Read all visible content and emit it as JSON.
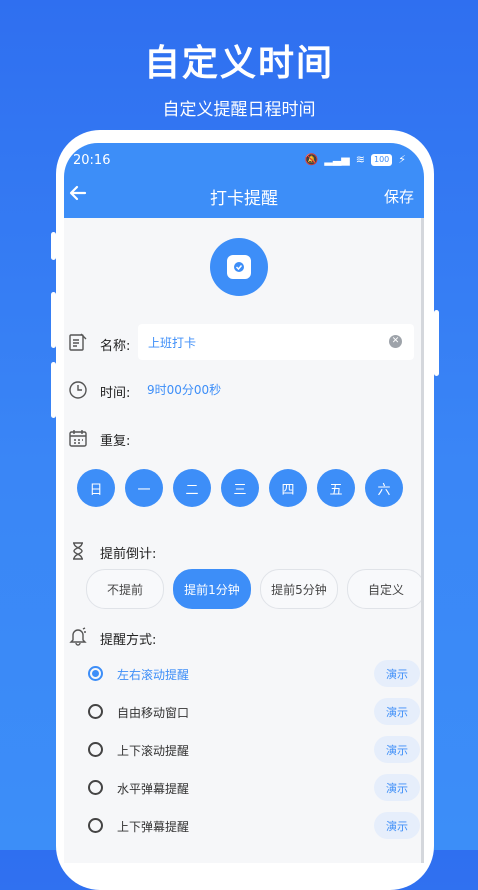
{
  "promo": {
    "headline": "自定义时间",
    "subline": "自定义提醒日程时间"
  },
  "status_bar": {
    "time": "20:16",
    "battery": "100"
  },
  "nav": {
    "title": "打卡提醒",
    "save_label": "保存"
  },
  "form": {
    "name_label": "名称:",
    "name_value": "上班打卡",
    "time_label": "时间:",
    "time_value": "9时00分00秒",
    "repeat_label": "重复:",
    "days": [
      "日",
      "一",
      "二",
      "三",
      "四",
      "五",
      "六"
    ],
    "countdown_label": "提前倒计:",
    "countdown_options": [
      "不提前",
      "提前1分钟",
      "提前5分钟",
      "自定义"
    ],
    "countdown_selected": "提前1分钟",
    "mode_label": "提醒方式:",
    "modes": [
      "左右滚动提醒",
      "自由移动窗口",
      "上下滚动提醒",
      "水平弹幕提醒",
      "上下弹幕提醒"
    ],
    "mode_selected": "左右滚动提醒",
    "demo_label": "演示"
  },
  "colors": {
    "accent": "#3d8ef8",
    "background": "#2f6ff0"
  }
}
